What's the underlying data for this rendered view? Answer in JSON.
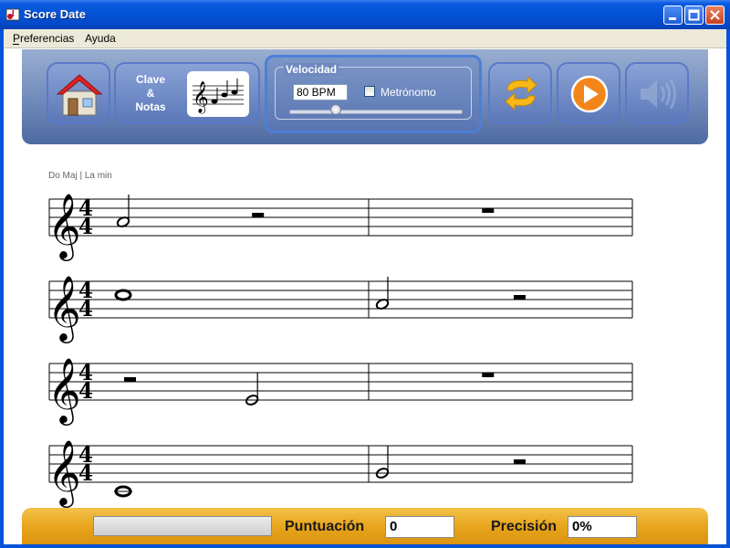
{
  "window": {
    "title": "Score Date"
  },
  "menu": {
    "items": [
      "Preferencias",
      "Ayuda"
    ]
  },
  "toolbar": {
    "clave_notas_label": [
      "Clave",
      "&",
      "Notas"
    ],
    "speed": {
      "legend": "Velocidad",
      "bpm_value": "80 BPM",
      "metronome_label": "Metrónomo",
      "metronome_checked": false,
      "slider_value": 0.27
    }
  },
  "score": {
    "key_label": "Do Maj | La min",
    "time_signature": {
      "top": "4",
      "bottom": "4"
    },
    "staves": [
      {
        "measures": [
          [
            {
              "type": "note",
              "duration": "half",
              "pitch": "A4"
            },
            {
              "type": "rest",
              "duration": "half"
            }
          ],
          [
            {
              "type": "rest",
              "duration": "whole"
            }
          ]
        ]
      },
      {
        "measures": [
          [
            {
              "type": "note",
              "duration": "whole",
              "pitch": "C5"
            }
          ],
          [
            {
              "type": "note",
              "duration": "half",
              "pitch": "A4"
            },
            {
              "type": "rest",
              "duration": "half"
            }
          ]
        ]
      },
      {
        "measures": [
          [
            {
              "type": "rest",
              "duration": "half"
            },
            {
              "type": "note",
              "duration": "half",
              "pitch": "E4"
            }
          ],
          [
            {
              "type": "rest",
              "duration": "whole"
            }
          ]
        ]
      },
      {
        "measures": [
          [
            {
              "type": "note",
              "duration": "whole",
              "pitch": "C4"
            }
          ],
          [
            {
              "type": "note",
              "duration": "half",
              "pitch": "G4"
            },
            {
              "type": "rest",
              "duration": "half"
            }
          ]
        ]
      }
    ]
  },
  "status": {
    "score_label": "Puntuación",
    "score_value": "0",
    "precision_label": "Precisión",
    "precision_value": "0%",
    "progress": 0
  },
  "icons": {
    "home": "home-icon",
    "loop": "loop-icon",
    "play": "play-icon",
    "volume": "volume-icon"
  }
}
